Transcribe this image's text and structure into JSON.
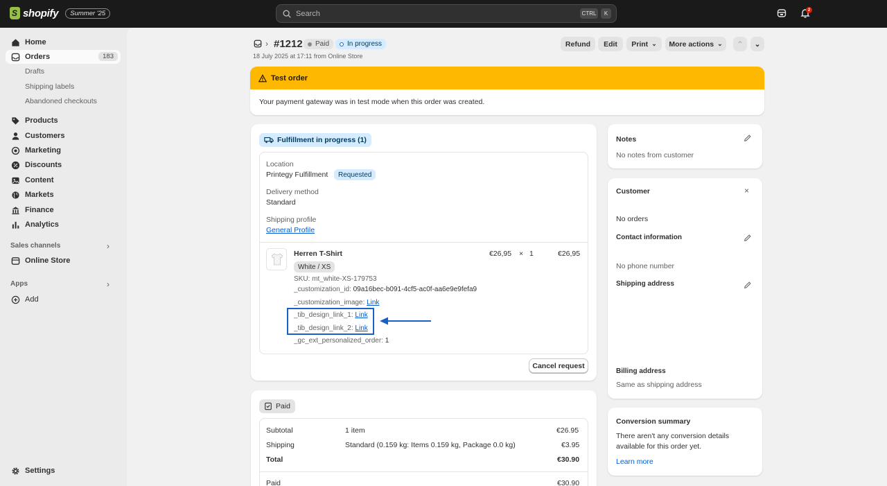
{
  "topbar": {
    "logo_text": "shopify",
    "edition": "Summer '25",
    "search_placeholder": "Search",
    "shortcut_1": "CTRL",
    "shortcut_2": "K",
    "notification_count": "2"
  },
  "sidebar": {
    "items": [
      {
        "label": "Home"
      },
      {
        "label": "Orders",
        "count": "183"
      },
      {
        "label": "Products"
      },
      {
        "label": "Customers"
      },
      {
        "label": "Marketing"
      },
      {
        "label": "Discounts"
      },
      {
        "label": "Content"
      },
      {
        "label": "Markets"
      },
      {
        "label": "Finance"
      },
      {
        "label": "Analytics"
      }
    ],
    "orders_sub": [
      "Drafts",
      "Shipping labels",
      "Abandoned checkouts"
    ],
    "sales_channels_label": "Sales channels",
    "online_store": "Online Store",
    "apps_label": "Apps",
    "add_label": "Add",
    "settings_label": "Settings"
  },
  "order": {
    "number": "#1212",
    "payment_status": "Paid",
    "fulfillment_status": "In progress",
    "date": "18 July 2025 at 17:11 from Online Store",
    "actions": {
      "refund": "Refund",
      "edit": "Edit",
      "print": "Print",
      "more": "More actions"
    }
  },
  "banner": {
    "title": "Test order",
    "message": "Your payment gateway was in test mode when this order was created."
  },
  "fulfillment": {
    "title": "Fulfillment in progress (1)",
    "location_label": "Location",
    "location_value": "Printegy Fulfillment",
    "location_status": "Requested",
    "delivery_label": "Delivery method",
    "delivery_value": "Standard",
    "shipping_profile_label": "Shipping profile",
    "shipping_profile_value": "General Profile",
    "item": {
      "name": "Herren T-Shirt",
      "variant": "White / XS",
      "price": "€26,95",
      "times": "×",
      "qty": "1",
      "total": "€26,95",
      "sku": "SKU: mt_white-XS-179753",
      "customization_id_label": "_customization_id:",
      "customization_id_value": "09a16bec-b091-4cf5-ac0f-aa6e9e9fefa9",
      "customization_image_label": "_customization_image:",
      "tib_link_1_label": "_tib_design_link_1:",
      "tib_link_2_label": "_tib_design_link_2:",
      "gc_ext_label": "_gc_ext_personalized_order:",
      "gc_ext_value": "1",
      "link_text": "Link"
    },
    "cancel_button": "Cancel request"
  },
  "payment": {
    "title": "Paid",
    "rows": [
      {
        "label": "Subtotal",
        "desc": "1 item",
        "amount": "€26.95"
      },
      {
        "label": "Shipping",
        "desc": "Standard (0.159 kg: Items 0.159 kg, Package 0.0 kg)",
        "amount": "€3.95"
      },
      {
        "label": "Total",
        "desc": "",
        "amount": "€30.90"
      }
    ],
    "paid_label": "Paid",
    "paid_amount": "€30.90"
  },
  "notes": {
    "title": "Notes",
    "text": "No notes from customer"
  },
  "customer": {
    "title": "Customer",
    "orders": "No orders",
    "contact_title": "Contact information",
    "phone": "No phone number",
    "shipping_title": "Shipping address",
    "billing_title": "Billing address",
    "billing_text": "Same as shipping address"
  },
  "conversion": {
    "title": "Conversion summary",
    "text_1": "There aren't any conversion details",
    "text_2": "available for this order yet.",
    "link": "Learn more"
  },
  "colors": {
    "banner": "#ffb800",
    "highlight": "#1a5fc4",
    "link": "#005bd3"
  }
}
